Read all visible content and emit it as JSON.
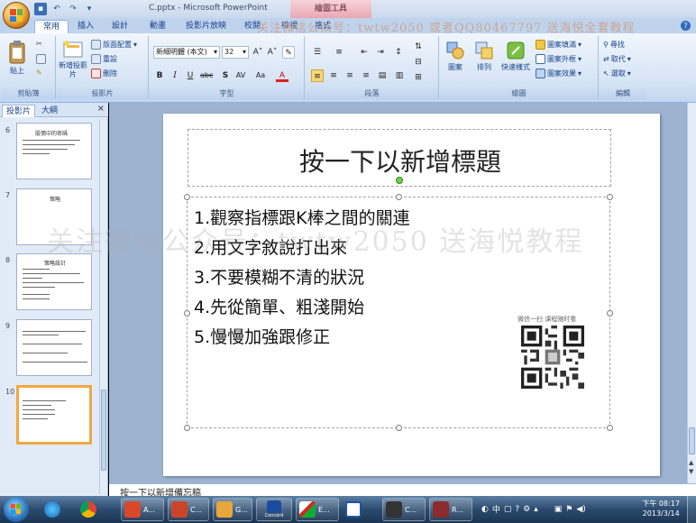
{
  "window": {
    "title": "C.pptx - Microsoft PowerPoint",
    "tool_tab": "繪圖工具"
  },
  "watermark_top": "关注微信公众号：twtw2050 或者QQ80467797 送海悦全套教程",
  "watermark_mid": "关注微信公众号：twtw2050 送海悦教程",
  "tabs": [
    "常用",
    "插入",
    "設計",
    "動畫",
    "投影片放映",
    "校閱",
    "檢視",
    "格式"
  ],
  "ribbon": {
    "clipboard": {
      "label": "剪貼簿",
      "paste": "貼上"
    },
    "slides": {
      "label": "投影片",
      "new_slide": "新增投影片",
      "layout": "版面配置",
      "reset": "重設",
      "delete": "刪除"
    },
    "font": {
      "label": "字型",
      "name": "新細明體 (本文)",
      "size": "32"
    },
    "paragraph": {
      "label": "段落"
    },
    "drawing": {
      "label": "繪圖",
      "shape": "圖案",
      "arrange": "排列",
      "quick_styles": "快速樣式",
      "fill": "圖案填滿",
      "outline": "圖案外框",
      "effects": "圖案效果"
    },
    "editing": {
      "label": "編輯",
      "find": "尋找",
      "replace": "取代",
      "select": "選取"
    }
  },
  "pane_tabs": [
    "投影片",
    "大綱"
  ],
  "thumbnails": [
    {
      "num": "6",
      "title": "股價中的密碼"
    },
    {
      "num": "7",
      "title": "策略"
    },
    {
      "num": "8",
      "title": "策略設計"
    },
    {
      "num": "9",
      "title": ""
    },
    {
      "num": "10",
      "title": ""
    }
  ],
  "slide": {
    "title": "按一下以新增標題",
    "bullets": [
      "1.觀察指標跟K棒之間的關連",
      "2.用文字敘說打出來",
      "3.不要模糊不清的狀況",
      "4.先從簡單、粗淺開始",
      "5.慢慢加強跟修正"
    ],
    "qr_caption": "微信一扫  课程随时看"
  },
  "notes": "按一下以新增備忘稿",
  "taskbar": {
    "items": [
      "A...",
      "C...",
      "G...",
      "Concord",
      "E...",
      "",
      "C...",
      "R..."
    ],
    "ime": "中",
    "time": "下午 08:17",
    "date": "2013/3/14"
  }
}
